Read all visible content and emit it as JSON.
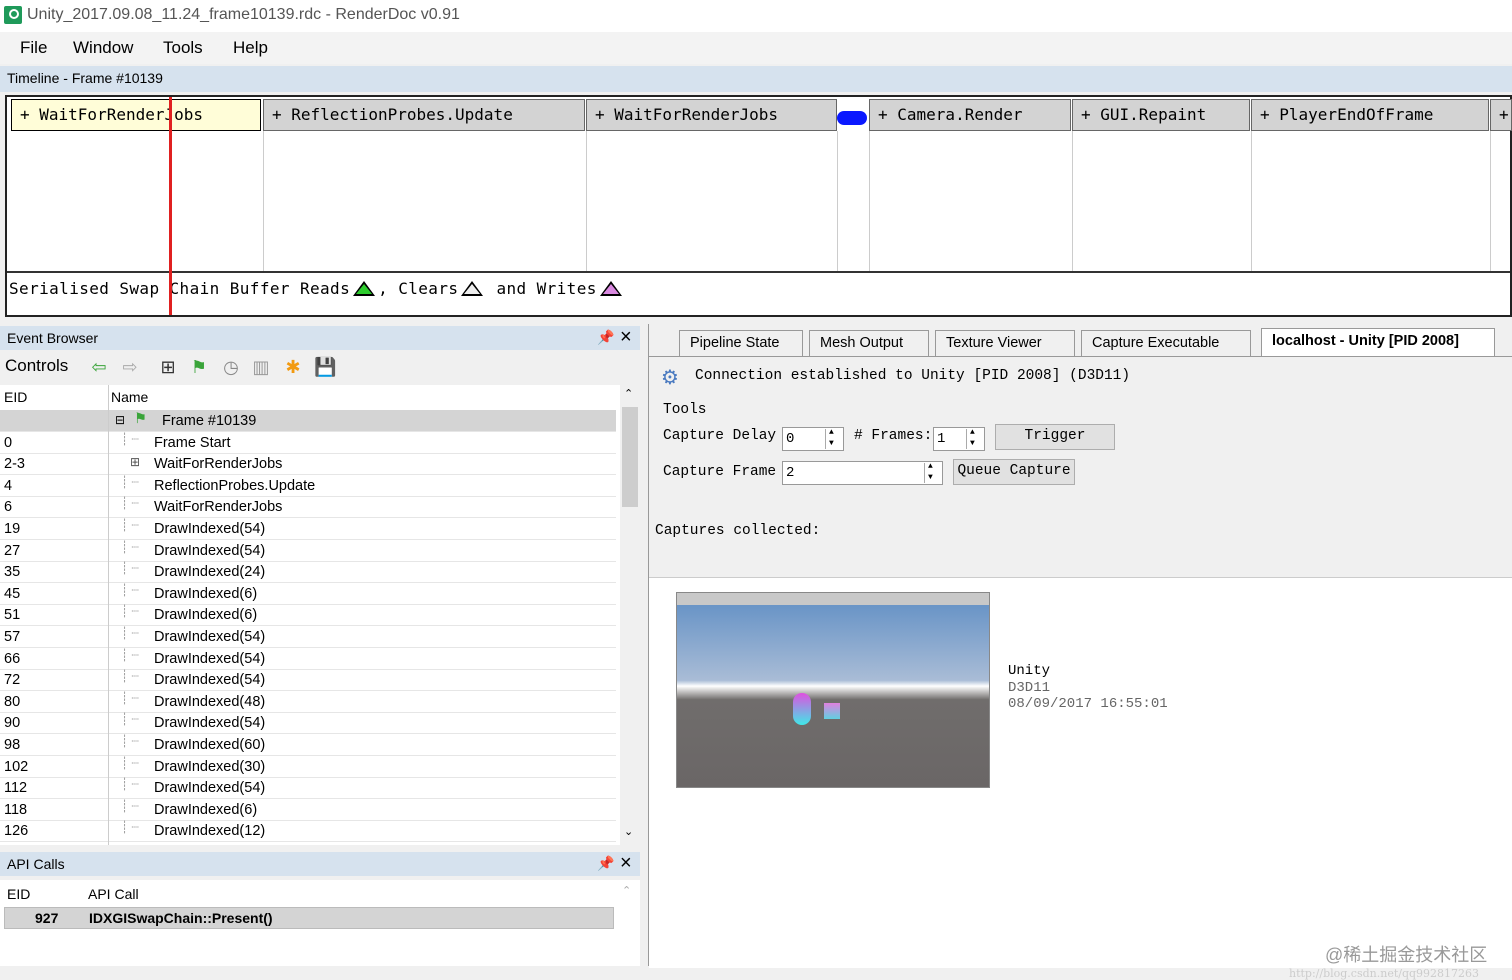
{
  "window": {
    "title": "Unity_2017.09.08_11.24_frame10139.rdc - RenderDoc v0.91"
  },
  "menu": [
    "File",
    "Window",
    "Tools",
    "Help"
  ],
  "timeline": {
    "header": "Timeline - Frame #10139",
    "blocks": [
      "+ WaitForRenderJobs",
      "+ ReflectionProbes.Update",
      "+ WaitForRenderJobs",
      "+ Camera.Render",
      "+ GUI.Repaint",
      "+ PlayerEndOfFrame",
      "+"
    ],
    "swap_prefix": "Serialised Swap Chain Buffer Reads",
    "swap_clears": ", Clears",
    "swap_writes": "and Writes"
  },
  "event_browser": {
    "title": "Event Browser",
    "controls_label": "Controls",
    "col_eid": "EID",
    "col_name": "Name",
    "frame_row": "Frame #10139",
    "rows": [
      {
        "eid": "0",
        "name": "Frame Start"
      },
      {
        "eid": "2-3",
        "name": "WaitForRenderJobs"
      },
      {
        "eid": "4",
        "name": "ReflectionProbes.Update"
      },
      {
        "eid": "6",
        "name": "WaitForRenderJobs"
      },
      {
        "eid": "19",
        "name": "DrawIndexed(54)"
      },
      {
        "eid": "27",
        "name": "DrawIndexed(54)"
      },
      {
        "eid": "35",
        "name": "DrawIndexed(24)"
      },
      {
        "eid": "45",
        "name": "DrawIndexed(6)"
      },
      {
        "eid": "51",
        "name": "DrawIndexed(6)"
      },
      {
        "eid": "57",
        "name": "DrawIndexed(54)"
      },
      {
        "eid": "66",
        "name": "DrawIndexed(54)"
      },
      {
        "eid": "72",
        "name": "DrawIndexed(54)"
      },
      {
        "eid": "80",
        "name": "DrawIndexed(48)"
      },
      {
        "eid": "90",
        "name": "DrawIndexed(54)"
      },
      {
        "eid": "98",
        "name": "DrawIndexed(60)"
      },
      {
        "eid": "102",
        "name": "DrawIndexed(30)"
      },
      {
        "eid": "112",
        "name": "DrawIndexed(54)"
      },
      {
        "eid": "118",
        "name": "DrawIndexed(6)"
      },
      {
        "eid": "126",
        "name": "DrawIndexed(12)"
      }
    ]
  },
  "api_calls": {
    "title": "API Calls",
    "col_eid": "EID",
    "col_call": "API Call",
    "row_eid": "927",
    "row_call": "IDXGISwapChain::Present()"
  },
  "tabs": [
    "Pipeline State",
    "Mesh Output",
    "Texture Viewer",
    "Capture Executable",
    "localhost - Unity [PID 2008]"
  ],
  "connection": {
    "status": "Connection established to Unity [PID 2008] (D3D11)",
    "tools_label": "Tools",
    "capture_delay_label": "Capture Delay",
    "capture_delay_value": "0",
    "frames_label": "# Frames:",
    "frames_value": "1",
    "trigger_label": "Trigger",
    "capture_frame_label": "Capture Frame #",
    "capture_frame_value": "2",
    "queue_capture_label": "Queue Capture",
    "captures_label": "Captures collected:",
    "capture": {
      "app": "Unity",
      "api": "D3D11",
      "time": "08/09/2017 16:55:01"
    }
  },
  "watermark": "@稀土掘金技术社区",
  "watermark_url": "http://blog.csdn.net/qq992817263"
}
